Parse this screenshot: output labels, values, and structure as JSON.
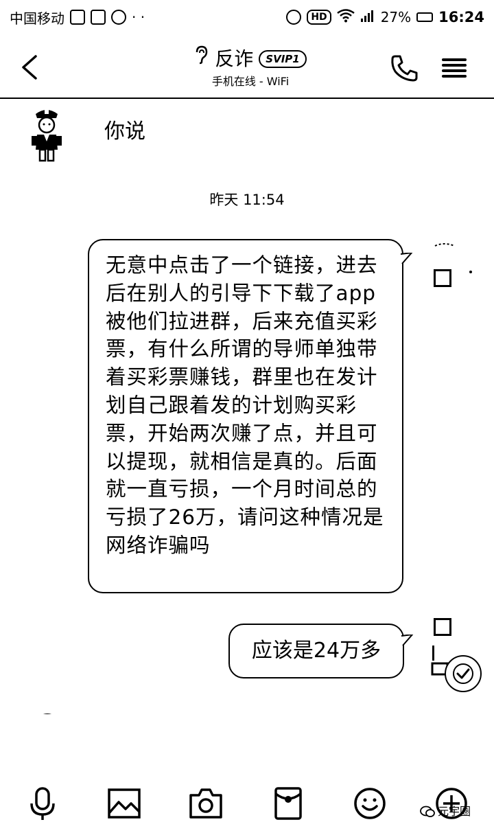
{
  "status_bar": {
    "carrier_text": "中国移动",
    "hd_label": "HD",
    "battery_percent": "27%",
    "time": "16:24"
  },
  "header": {
    "contact_name": "反诈",
    "svip_badge": "SVIP1",
    "online_status": "手机在线 - WiFi"
  },
  "chat": {
    "incoming_message": "你说",
    "timestamp": "昨天 11:54",
    "outgoing_messages": [
      {
        "text": "无意中点击了一个链接，进去后在别人的引导下下载了app被他们拉进群，后来充值买彩票，有什么所谓的导师单独带着买彩票赚钱，群里也在发计划自己跟着发的计划购买彩票，开始两次赚了点，并且可以提现，就相信是真的。后面就一直亏损，一个月时间总的亏损了26万，请问这种情况是网络诈骗吗"
      },
      {
        "text": "应该是24万多"
      }
    ]
  },
  "toolbar": {
    "items": [
      "voice",
      "image",
      "camera",
      "red-packet",
      "emoji",
      "more"
    ]
  },
  "watermark": {
    "text": "元宇圈"
  },
  "colors": {
    "background": "#ffffff",
    "foreground": "#000000"
  }
}
